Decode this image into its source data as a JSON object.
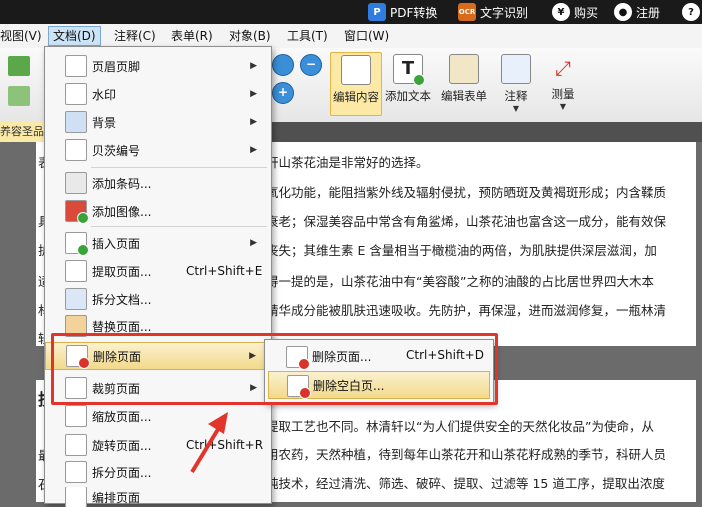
{
  "titlebar": {
    "pdf_convert": "PDF转换",
    "ocr": "文字识别",
    "ocr_badge": "OCR",
    "buy": "购买",
    "register": "注册",
    "help": "?"
  },
  "menubar": {
    "items": [
      "视图(V)",
      "文档(D)",
      "注释(C)",
      "表单(R)",
      "对象(B)",
      "工具(T)",
      "窗口(W)"
    ]
  },
  "toolbar": {
    "edit_content": "编辑内容",
    "add_text": "添加文本",
    "edit_form": "编辑表单",
    "annotate": "注释",
    "measure": "测量"
  },
  "tab": {
    "label": "养容圣品-"
  },
  "doc_menu": {
    "items": [
      {
        "label": "页眉页脚",
        "shortcut": "",
        "submenu": true
      },
      {
        "label": "水印",
        "shortcut": "",
        "submenu": true
      },
      {
        "label": "背景",
        "shortcut": "",
        "submenu": true
      },
      {
        "label": "贝茨编号",
        "shortcut": "",
        "submenu": true
      },
      {
        "label": "添加条码...",
        "shortcut": "",
        "submenu": false
      },
      {
        "label": "添加图像...",
        "shortcut": "",
        "submenu": false
      },
      {
        "label": "插入页面",
        "shortcut": "",
        "submenu": true
      },
      {
        "label": "提取页面...",
        "shortcut": "Ctrl+Shift+E",
        "submenu": false
      },
      {
        "label": "拆分文档...",
        "shortcut": "",
        "submenu": false
      },
      {
        "label": "替换页面...",
        "shortcut": "",
        "submenu": false
      },
      {
        "label": "删除页面",
        "shortcut": "",
        "submenu": true
      },
      {
        "label": "裁剪页面",
        "shortcut": "",
        "submenu": true
      },
      {
        "label": "缩放页面...",
        "shortcut": "",
        "submenu": false
      },
      {
        "label": "旋转页面...",
        "shortcut": "Ctrl+Shift+R",
        "submenu": false
      },
      {
        "label": "拆分页面...",
        "shortcut": "",
        "submenu": false
      },
      {
        "label": "编排页面",
        "shortcut": "",
        "submenu": false
      }
    ]
  },
  "delete_submenu": {
    "items": [
      {
        "label": "删除页面...",
        "shortcut": "Ctrl+Shift+D"
      },
      {
        "label": "删除空白页..."
      }
    ]
  },
  "document": {
    "page1_lines": [
      "轩山茶花油是非常好的选择。",
      "氧化功能，能阻挡紫外线及辐射侵扰，预防晒斑及黄褐斑形成；内含鞣质",
      "衰老；保湿美容品中常含有角鲨烯，山茶花油也富含这一成分，能有效保",
      "丧失；其维生素 E 含量相当于橄榄油的两倍，为肌肤提供深层滋润，加",
      "得一提的是，山茶花油中有“美容酸”之称的油酸的占比居世界四大木本",
      "精华成分能被肌肤迅速吸收。先防护，再保湿，进而滋润修复，一瓶林清"
    ],
    "page2_lines": [
      "提取工艺也不同。林清轩以“为人们提供安全的天然化妆品”为使命，从",
      "用农药，天然种植，待到每年山茶花开和山茶花籽成熟的季节，科研人员",
      "纯技术，经过清洗、筛选、破碎、提取、过滤等 15 道工序，提取出浓度"
    ],
    "left_chars": [
      "表",
      "具",
      "护",
      "适",
      "材",
      "轻",
      "技",
      "最",
      "石"
    ]
  }
}
